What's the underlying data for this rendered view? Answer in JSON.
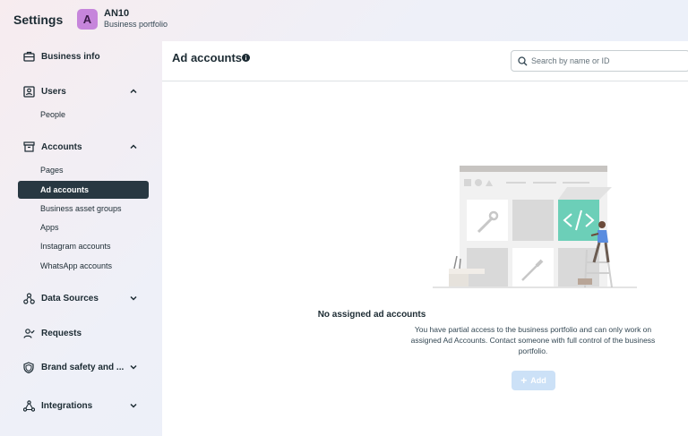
{
  "header": {
    "settings_title": "Settings",
    "avatar_letter": "A",
    "business_name": "AN10",
    "business_subtitle": "Business portfolio"
  },
  "sidebar": {
    "business_info": "Business info",
    "users": "Users",
    "people": "People",
    "accounts": "Accounts",
    "pages": "Pages",
    "ad_accounts": "Ad accounts",
    "business_asset_groups": "Business asset groups",
    "apps": "Apps",
    "instagram_accounts": "Instagram accounts",
    "whatsapp_accounts": "WhatsApp accounts",
    "data_sources": "Data Sources",
    "requests": "Requests",
    "brand_safety": "Brand safety and ...",
    "integrations": "Integrations"
  },
  "main": {
    "title": "Ad accounts",
    "search_placeholder": "Search by name or ID",
    "empty_title": "No assigned ad accounts",
    "empty_description": "You have partial access to the business portfolio and can only work on assigned Ad Accounts. Contact someone with full control of the business portfolio.",
    "add_label": "Add"
  },
  "colors": {
    "active_nav_bg": "#283842",
    "avatar_bg": "#c685db",
    "add_button_disabled": "#cce1f7",
    "illustration_accent": "#6ccfb8"
  }
}
